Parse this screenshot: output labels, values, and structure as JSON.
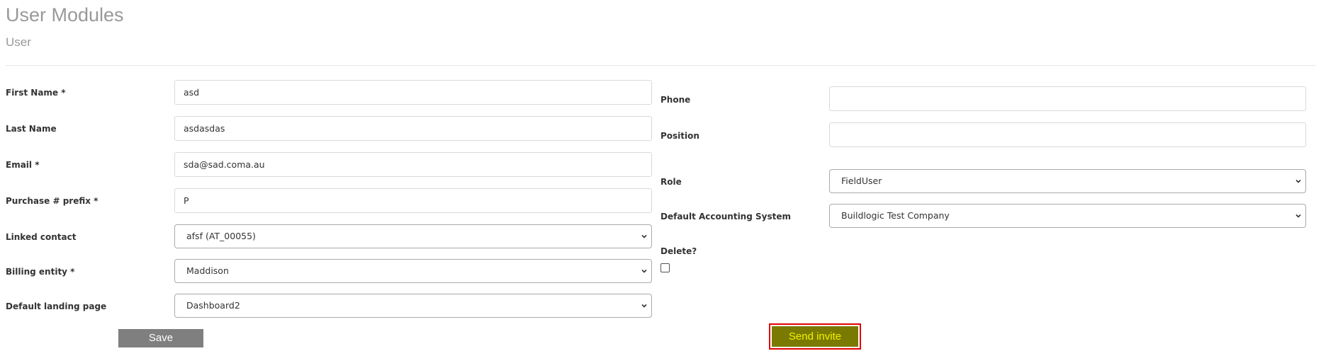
{
  "header": {
    "title": "User Modules",
    "subtitle": "User"
  },
  "left_form": {
    "first_name": {
      "label": "First Name *",
      "value": "asd"
    },
    "last_name": {
      "label": "Last Name",
      "value": "asdasdas"
    },
    "email": {
      "label": "Email *",
      "value": "sda@sad.coma.au"
    },
    "purchase_prefix": {
      "label": "Purchase # prefix *",
      "value": "P"
    },
    "linked_contact": {
      "label": "Linked contact",
      "selected": "afsf (AT_00055)"
    },
    "billing_entity": {
      "label": "Billing entity *",
      "selected": "Maddison"
    },
    "default_landing_page": {
      "label": "Default landing page",
      "selected": "Dashboard2"
    }
  },
  "right_form": {
    "phone": {
      "label": "Phone",
      "value": ""
    },
    "position": {
      "label": "Position",
      "value": ""
    },
    "role": {
      "label": "Role",
      "selected": "FieldUser"
    },
    "default_accounting_system": {
      "label": "Default Accounting System",
      "selected": "Buildlogic Test Company"
    },
    "delete": {
      "label": "Delete?",
      "checked": false
    }
  },
  "actions": {
    "save_label": "Save",
    "send_invite_label": "Send invite"
  }
}
